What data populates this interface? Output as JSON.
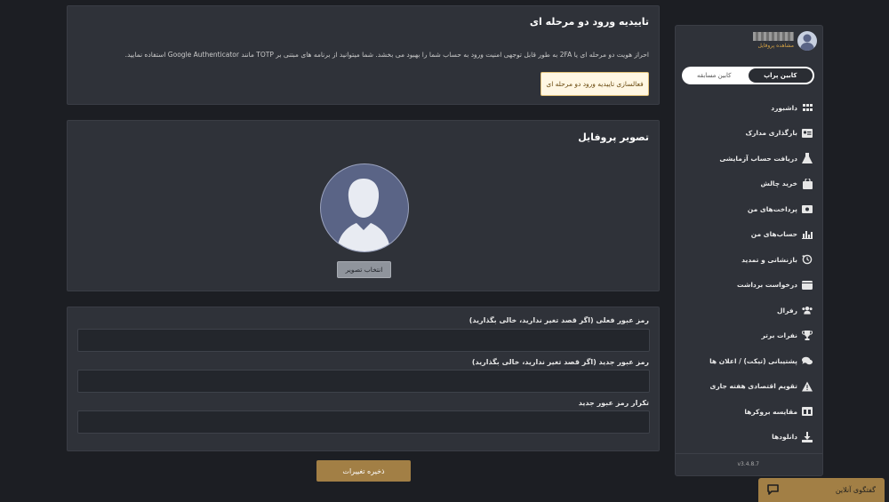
{
  "two_factor": {
    "title": "تاییدیه ورود دو مرحله ای",
    "description": "احراز هویت دو مرحله ای یا 2FA به طور قابل توجهی امنیت ورود به حساب شما را بهبود می بخشد. شما میتوانید از برنامه های مبتنی بر TOTP مانند Google Authenticator استفاده نمایید.",
    "enable_button": "فعالسازی تاییدیه ورود دو مرحله ای"
  },
  "profile_picture": {
    "title": "تصویر پروفایل",
    "choose_button": "انتخاب تصویر"
  },
  "password": {
    "current_label": "رمز عبور فعلی (اگر قصد تغیر ندارید، خالی بگذارید)",
    "new_label": "رمز عبور جدید (اگر قصد تغیر ندارید، خالی بگذارید)",
    "confirm_label": "تکرار رمز عبور جدید",
    "current_value": "",
    "new_value": "",
    "confirm_value": ""
  },
  "save_button": "ذخیره تغییرات",
  "sidebar": {
    "profile_link": "مشاهده پروفایل",
    "toggle": {
      "active": "کابین پراپ",
      "inactive": "کابین مسابقه"
    },
    "menu": [
      {
        "label": "داشبورد",
        "icon": "grid-icon"
      },
      {
        "label": "بارگذاری مدارک",
        "icon": "id-card-icon"
      },
      {
        "label": "دریافت حساب آزمایشی",
        "icon": "flask-icon"
      },
      {
        "label": "خرید چالش",
        "icon": "shopping-bag-icon"
      },
      {
        "label": "پرداخت‌های من",
        "icon": "money-bill-icon"
      },
      {
        "label": "حساب‌های من",
        "icon": "bar-chart-icon"
      },
      {
        "label": "بازنشانی و تمدید",
        "icon": "history-icon"
      },
      {
        "label": "درخواست برداشت",
        "icon": "wallet-icon"
      },
      {
        "label": "رفرال",
        "icon": "users-icon"
      },
      {
        "label": "نفرات برتر",
        "icon": "trophy-icon"
      },
      {
        "label": "پشتیبانی (تیکت) / اعلان ها",
        "icon": "chat-bubbles-icon"
      },
      {
        "label": "تقویم اقتصادی هفته جاری",
        "icon": "warning-icon"
      },
      {
        "label": "مقایسه بروکرها",
        "icon": "columns-icon"
      },
      {
        "label": "دانلودها",
        "icon": "download-icon"
      }
    ],
    "version": "v3.4.8.7"
  },
  "chat": {
    "label": "گفتگوی آنلاین"
  }
}
